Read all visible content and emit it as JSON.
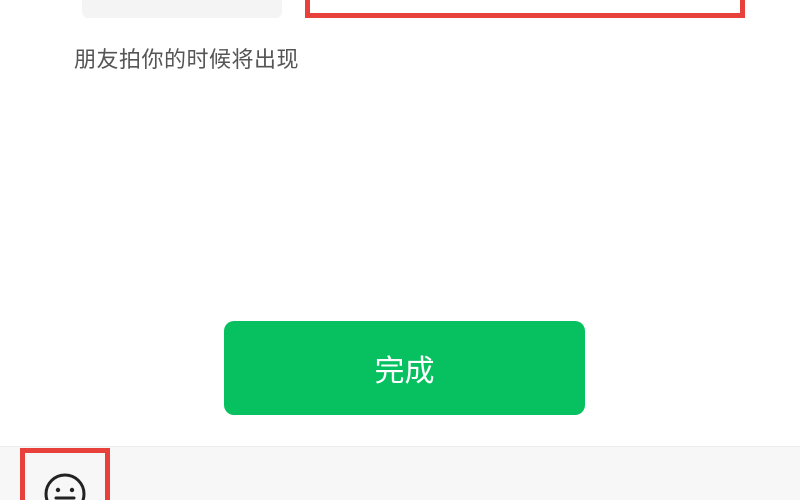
{
  "hint": {
    "text": "朋友拍你的时候将出现"
  },
  "actions": {
    "done_label": "完成"
  },
  "toolbar": {
    "emoji_icon": "emoji-face-icon"
  },
  "colors": {
    "accent_green": "#07c160",
    "highlight_red": "#e8413b",
    "hint_gray": "#555555"
  }
}
